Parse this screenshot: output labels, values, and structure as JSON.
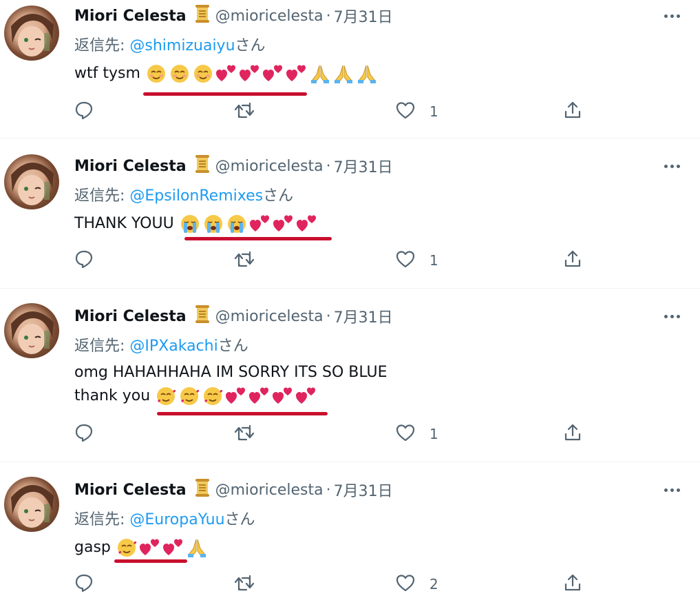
{
  "author": {
    "name": "Miori Celesta",
    "handle": "@mioricelesta",
    "date": "7月31日",
    "separator": "·"
  },
  "colors": {
    "text": "#0f1419",
    "muted": "#536471",
    "mention": "#1d9bf0",
    "underline_annotation": "#c8102e"
  },
  "icons": [
    "scroll-icon",
    "more-icon",
    "reply-icon",
    "retweet-icon",
    "like-icon",
    "share-icon",
    "smiling-face-emoji",
    "two-hearts-emoji",
    "folded-hands-emoji",
    "loudly-crying-face-emoji",
    "smiling-face-with-hearts-emoji"
  ],
  "tweets": [
    {
      "reply_prefix": "返信先: ",
      "reply_mention": "@shimizuaiyu",
      "reply_suffix": "さん",
      "text_line1": "wtf tysm",
      "text_line2": "",
      "emoji_sequence": [
        "smiling-face",
        "smiling-face",
        "smiling-face",
        "two-hearts",
        "two-hearts",
        "two-hearts",
        "two-hearts",
        "folded-hands",
        "folded-hands",
        "folded-hands"
      ],
      "like_count": "1"
    },
    {
      "reply_prefix": "返信先: ",
      "reply_mention": "@EpsilonRemixes",
      "reply_suffix": "さん",
      "text_line1": "THANK YOUU",
      "text_line2": "",
      "emoji_sequence": [
        "loudly-crying-face",
        "loudly-crying-face",
        "loudly-crying-face",
        "two-hearts",
        "two-hearts",
        "two-hearts"
      ],
      "like_count": "1"
    },
    {
      "reply_prefix": "返信先: ",
      "reply_mention": "@IPXakachi",
      "reply_suffix": "さん",
      "text_line1": "omg HAHAHHAHA IM SORRY ITS SO BLUE",
      "text_line2": "thank you",
      "emoji_sequence": [
        "smiling-face-with-hearts",
        "smiling-face-with-hearts",
        "smiling-face-with-hearts",
        "two-hearts",
        "two-hearts",
        "two-hearts",
        "two-hearts"
      ],
      "like_count": "1"
    },
    {
      "reply_prefix": "返信先: ",
      "reply_mention": "@EuropaYuu",
      "reply_suffix": "さん",
      "text_line1": "gasp",
      "text_line2": "",
      "emoji_sequence": [
        "smiling-face-with-hearts",
        "two-hearts",
        "two-hearts",
        "folded-hands"
      ],
      "like_count": "2"
    }
  ]
}
